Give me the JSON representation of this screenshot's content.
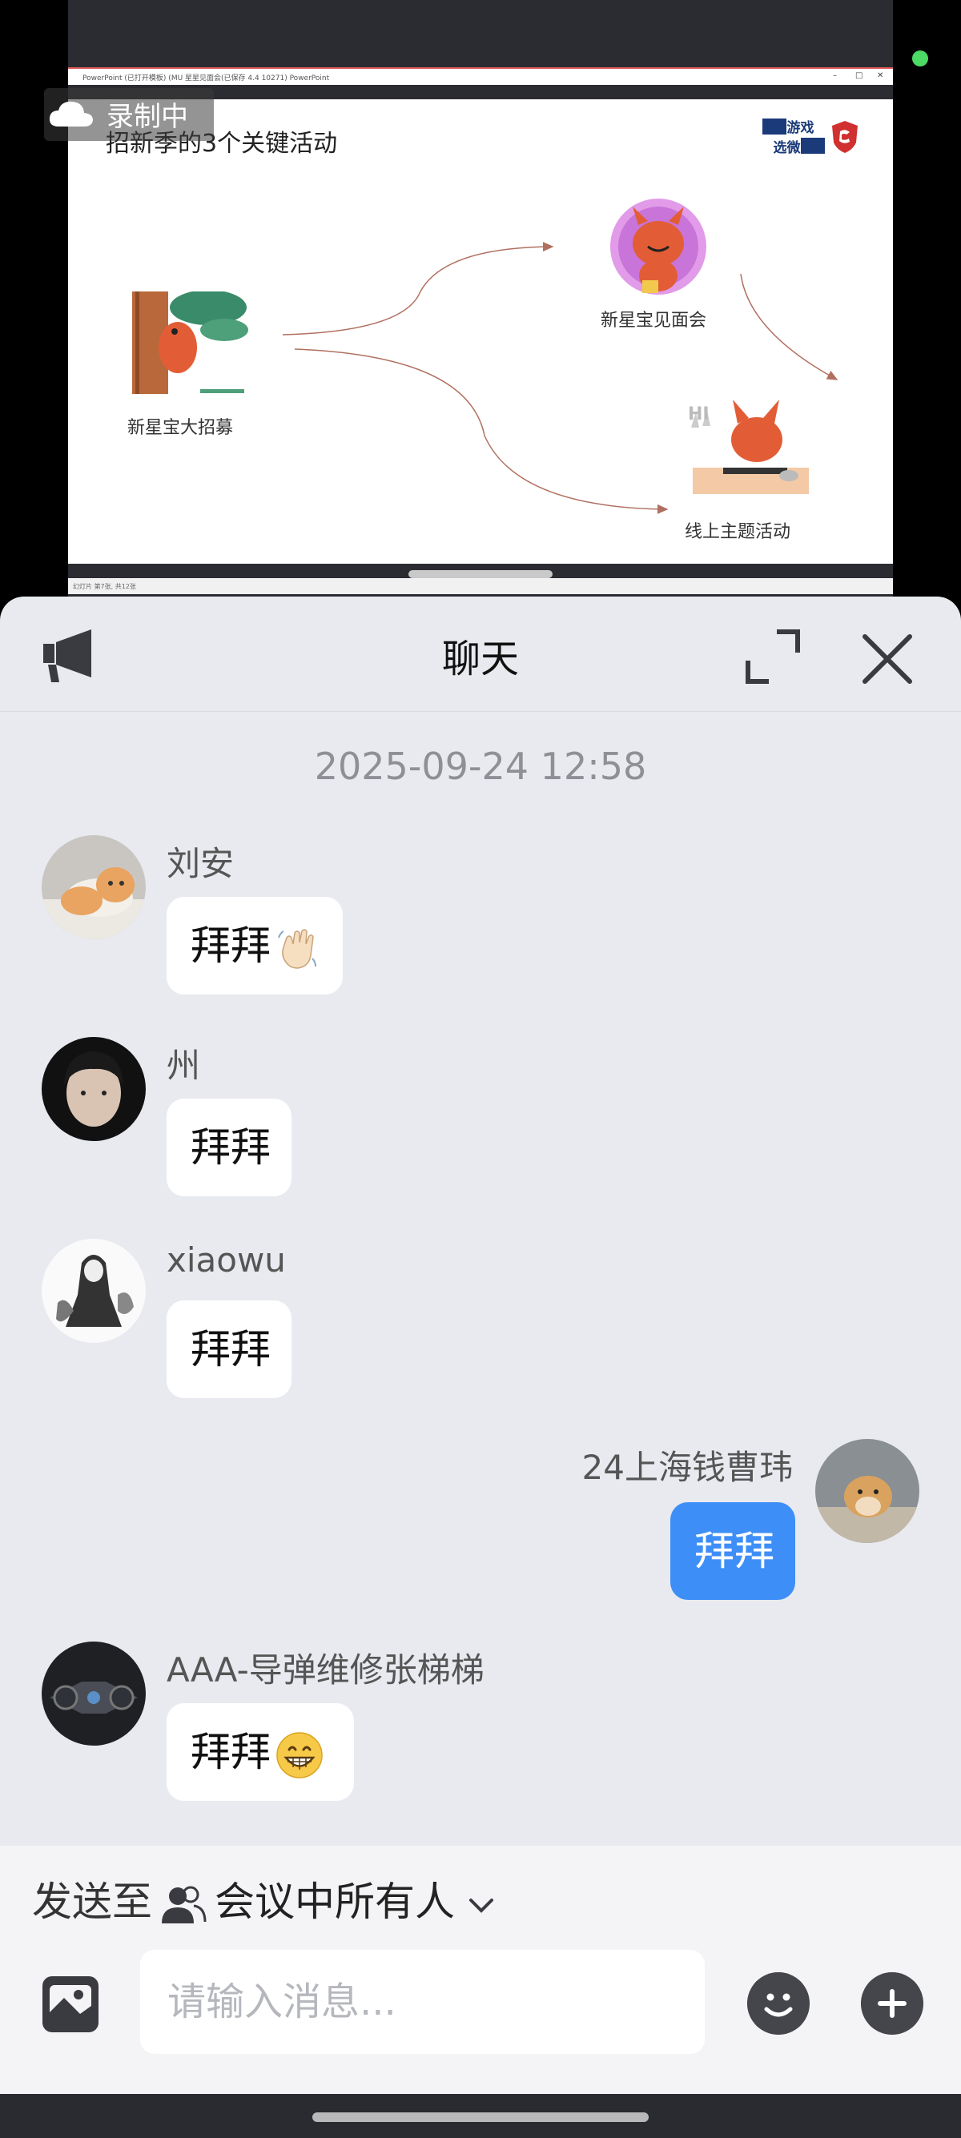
{
  "share": {
    "app_title": "PowerPoint (已打开模板)   (MU 星星见面会(已保存 4.4 10271)   PowerPoint",
    "recording_label": "录制中",
    "slide": {
      "title": "招新季的3个关键活动",
      "brand_lines": [
        "打游戏",
        "选微星"
      ],
      "nodes": [
        "新星宝大招募",
        "新星宝见面会",
        "线上主题活动"
      ]
    },
    "statusbar_text": "幻灯片 第7张, 共12张",
    "colors": {
      "accent_red": "#d03030",
      "arrow": "#b07060"
    }
  },
  "chat": {
    "title": "聊天",
    "date": "2025-09-24 12:58",
    "messages": [
      {
        "sender": "刘安",
        "text": "拜拜",
        "emoji": "waving-hand",
        "mine": false
      },
      {
        "sender": "州",
        "text": "拜拜",
        "emoji": "",
        "mine": false
      },
      {
        "sender": "xiaowu",
        "text": "拜拜",
        "emoji": "",
        "mine": false
      },
      {
        "sender": "24上海钱曹玮",
        "text": "拜拜",
        "emoji": "",
        "mine": true
      },
      {
        "sender": "AAA-导弹维修张梯梯",
        "text": "拜拜",
        "emoji": "grinning-face",
        "mine": false
      }
    ],
    "colors": {
      "mine_bubble": "#3e8ef7",
      "other_bubble": "#ffffff"
    }
  },
  "composer": {
    "send_to_label": "发送至",
    "recipient": "会议中所有人",
    "placeholder": "请输入消息..."
  }
}
